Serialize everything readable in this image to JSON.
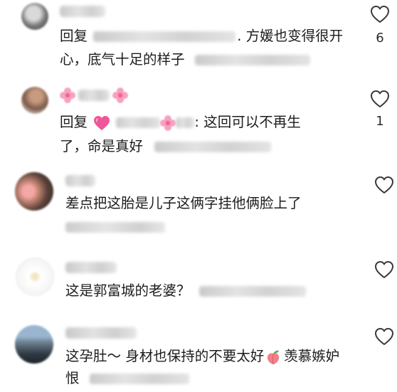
{
  "comments": [
    {
      "reply_prefix": "回复",
      "text_line1": ". 方媛也变得很开",
      "text_line2": "心，底气十足的样子",
      "like_count": "6"
    },
    {
      "reply_prefix": "回复",
      "text_line1": ": 这回可以不再生",
      "text_line2": "了，命是真好",
      "like_count": "1"
    },
    {
      "text_line1": "差点把这胎是儿子这俩字挂他俩脸上了"
    },
    {
      "text_line1": "这是郭富城的老婆？"
    },
    {
      "text_line1": "这孕肚～ 身材也保持的不要太好",
      "text_line1_suffix": "羡慕嫉妒",
      "text_line2": "恨"
    }
  ],
  "icons": {
    "like": "heart-outline-icon",
    "pink_heart": "pink-heart-emoji-icon",
    "flower": "pink-flower-emoji-icon",
    "peach": "peach-emoji-icon"
  },
  "colors": {
    "text": "#1c1c1c",
    "icon_stroke": "#3a3a3a",
    "pink_heart": "#f0569a",
    "peach": "#f27f8a"
  }
}
